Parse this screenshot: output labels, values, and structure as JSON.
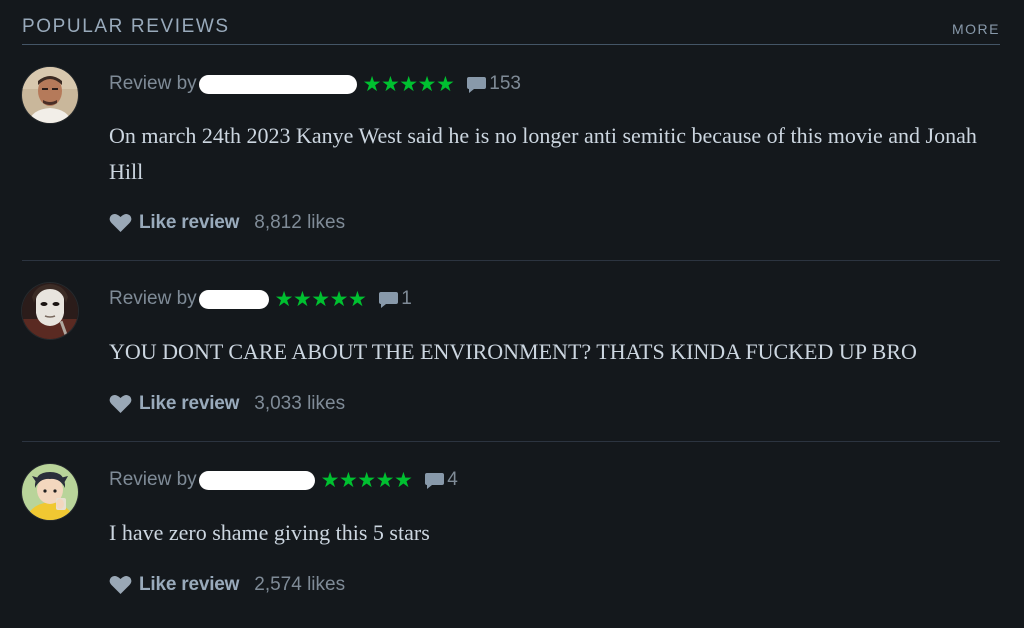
{
  "header": {
    "title": "POPULAR REVIEWS",
    "more_label": "MORE"
  },
  "reviews": [
    {
      "review_by_label": "Review by",
      "rating_stars": "★★★★★",
      "rating_value": 5,
      "comments": "153",
      "text": "On march 24th 2023 Kanye West said he is no longer anti semitic because of this movie and Jonah Hill",
      "like_label": "Like review",
      "likes": "8,812 likes"
    },
    {
      "review_by_label": "Review by",
      "rating_stars": "★★★★★",
      "rating_value": 5,
      "comments": "1",
      "text": "YOU DONT CARE ABOUT THE ENVIRONMENT? THATS KINDA FUCKED UP BRO",
      "like_label": "Like review",
      "likes": "3,033 likes"
    },
    {
      "review_by_label": "Review by",
      "rating_stars": "★★★★★",
      "rating_value": 5,
      "comments": "4",
      "text": "I have zero shame giving this 5 stars",
      "like_label": "Like review",
      "likes": "2,574 likes"
    }
  ],
  "colors": {
    "background": "#14181c",
    "star_green": "#00c030",
    "body_text": "#ccd6e0",
    "muted_text": "#7f8b97",
    "divider": "#2c3440"
  },
  "icons": {
    "comment": "comment-icon",
    "like": "heart-icon",
    "star": "star-icon"
  }
}
